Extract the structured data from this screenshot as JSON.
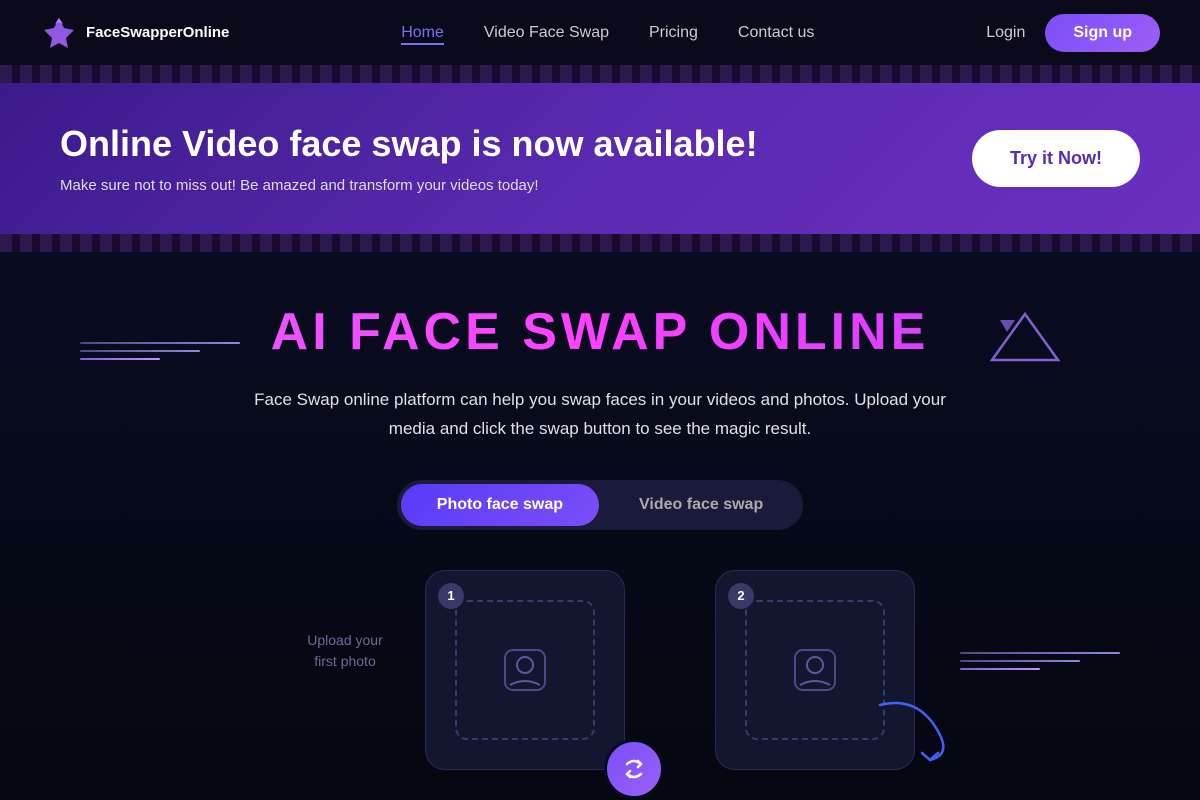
{
  "nav": {
    "logo_text": "FaceSwapperOnline",
    "links": [
      {
        "label": "Home",
        "active": true
      },
      {
        "label": "Video Face Swap",
        "active": false
      },
      {
        "label": "Pricing",
        "active": false
      },
      {
        "label": "Contact us",
        "active": false
      }
    ],
    "login_label": "Login",
    "signup_label": "Sign up"
  },
  "banner": {
    "headline": "Online Video face swap is now available!",
    "subtext": "Make sure not to miss out! Be amazed and transform your videos today!",
    "cta_label": "Try it Now!"
  },
  "main": {
    "title": "AI FACE SWAP ONLINE",
    "description": "Face Swap online platform can help you swap faces in your videos and photos. Upload your media and click the swap button to see the magic result.",
    "tabs": [
      {
        "label": "Photo face swap",
        "active": true
      },
      {
        "label": "Video face swap",
        "active": false
      }
    ],
    "side_label": "Upload your\nfirst photo",
    "card1_number": "1",
    "card2_number": "2"
  }
}
